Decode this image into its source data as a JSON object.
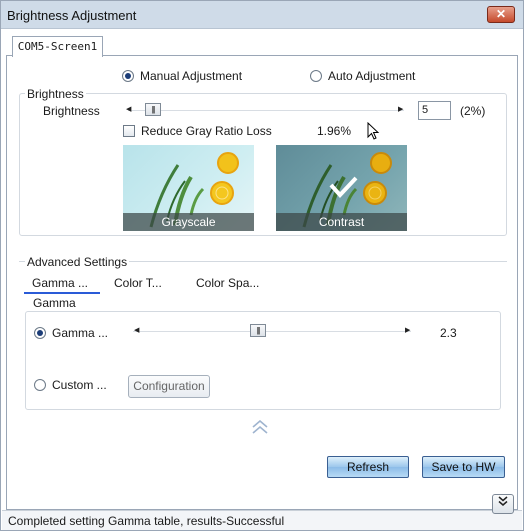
{
  "window": {
    "title": "Brightness Adjustment",
    "close_label": "✕"
  },
  "tab": {
    "label": "COM5-Screen1"
  },
  "mode": {
    "manual_label": "Manual Adjustment",
    "auto_label": "Auto Adjustment",
    "selected": "manual"
  },
  "brightness": {
    "group_label": "Brightness",
    "row_label": "Brightness",
    "value": "5",
    "percent": "(2%)",
    "level": 0.02,
    "reduce_label": "Reduce Gray Ratio Loss",
    "reduce_checked": false,
    "ratio": "1.96%",
    "thumbs": [
      {
        "caption": "Grayscale",
        "selected": false
      },
      {
        "caption": "Contrast",
        "selected": true
      }
    ]
  },
  "advanced": {
    "label": "Advanced Settings",
    "tabs": [
      "Gamma ...",
      "Color T...",
      "Color Spa..."
    ],
    "active_tab": 0,
    "gamma": {
      "group_label": "Gamma",
      "gamma_option_label": "Gamma ...",
      "gamma_value": "2.3",
      "gamma_level": 0.48,
      "custom_option_label": "Custom ...",
      "configuration_label": "Configuration"
    }
  },
  "buttons": {
    "refresh": "Refresh",
    "save": "Save to HW"
  },
  "status": {
    "text": "Completed setting Gamma table, results-Successful"
  },
  "colors": {
    "title_bar": "#cfdbe8",
    "accent_underline": "#2a5bd7",
    "button_blue": "#9cc7ec"
  }
}
